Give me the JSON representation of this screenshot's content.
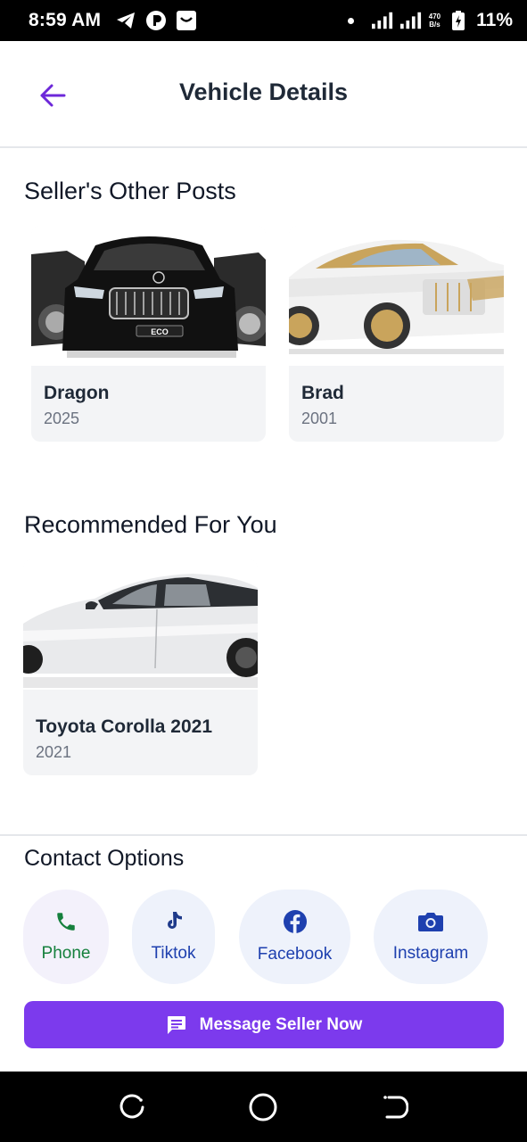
{
  "status_bar": {
    "time": "8:59 AM",
    "net_speed_value": "470",
    "net_speed_unit": "B/s",
    "battery": "11%"
  },
  "header": {
    "title": "Vehicle Details"
  },
  "sellers_posts": {
    "title": "Seller's Other Posts",
    "items": [
      {
        "name": "Dragon",
        "year": "2025"
      },
      {
        "name": "Brad",
        "year": "2001"
      }
    ]
  },
  "recommended": {
    "title": "Recommended For You",
    "items": [
      {
        "name": "Toyota Corolla 2021",
        "year": "2021"
      }
    ]
  },
  "contact": {
    "title": "Contact Options",
    "buttons": [
      {
        "label": "Phone",
        "color": "#15803d",
        "icon": "phone-icon"
      },
      {
        "label": "Tiktok",
        "color": "#1e40af",
        "icon": "tiktok-icon"
      },
      {
        "label": "Facebook",
        "color": "#1e40af",
        "icon": "facebook-icon"
      },
      {
        "label": "Instagram",
        "color": "#1e40af",
        "icon": "instagram-icon"
      }
    ],
    "message_label": "Message Seller Now"
  },
  "colors": {
    "accent": "#7c3aed",
    "nav": "#000000"
  },
  "car_badge": "ECO"
}
